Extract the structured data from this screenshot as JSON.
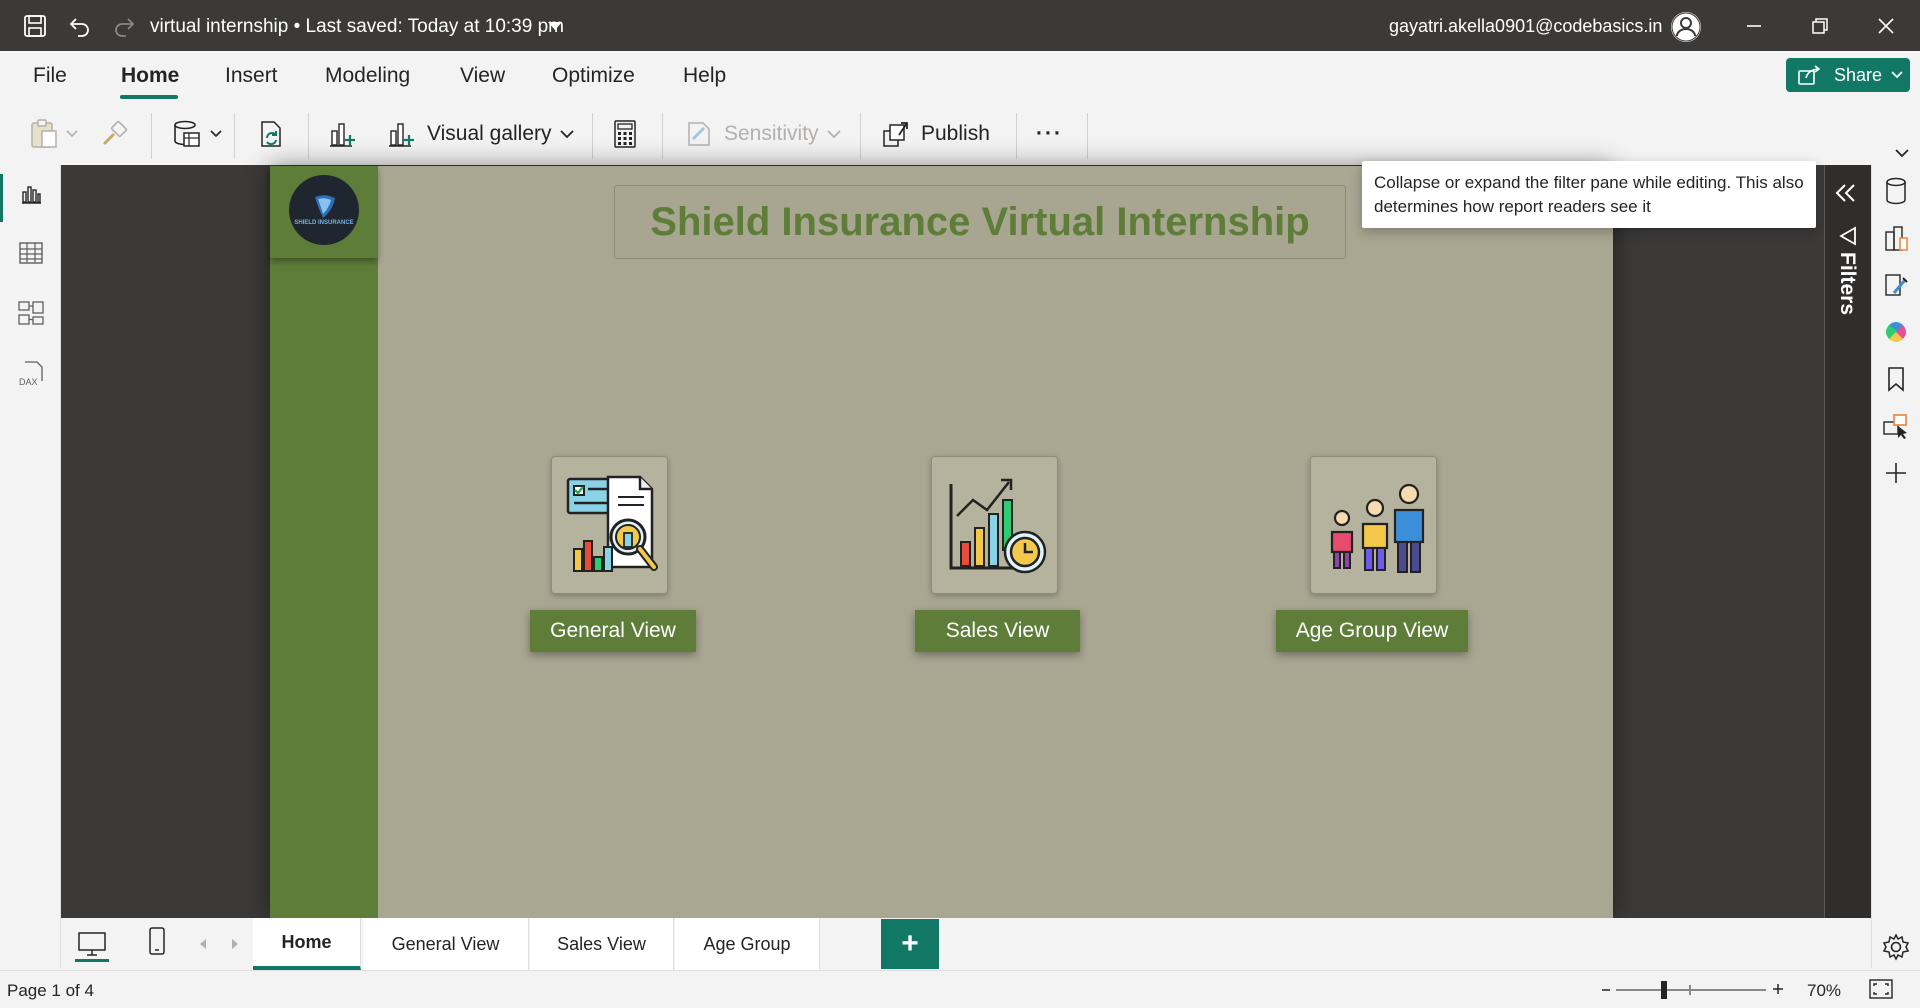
{
  "titlebar": {
    "doc_title": "virtual internship • Last saved: Today at 10:39 pm",
    "user_email": "gayatri.akella0901@codebasics.in"
  },
  "ribbon": {
    "tabs": [
      {
        "label": "File"
      },
      {
        "label": "Home"
      },
      {
        "label": "Insert"
      },
      {
        "label": "Modeling"
      },
      {
        "label": "View"
      },
      {
        "label": "Optimize"
      },
      {
        "label": "Help"
      }
    ],
    "active_tab": "Home",
    "share_label": "Share",
    "toolbar": {
      "visual_gallery": "Visual gallery",
      "sensitivity": "Sensitivity",
      "publish": "Publish",
      "more": "···"
    }
  },
  "report": {
    "logo_text": "SHIELD INSURANCE",
    "title": "Shield Insurance Virtual Internship",
    "nav_buttons": [
      {
        "label": "General View",
        "icon": "report-search-icon"
      },
      {
        "label": "Sales View",
        "icon": "sales-chart-icon"
      },
      {
        "label": "Age Group View",
        "icon": "age-group-icon"
      }
    ]
  },
  "tooltip": {
    "text": "Collapse or expand the filter pane while editing. This also determines how report readers see it"
  },
  "filters": {
    "label": "Filters"
  },
  "page_tabs": [
    {
      "label": "Home",
      "active": true
    },
    {
      "label": "General View",
      "active": false
    },
    {
      "label": "Sales View",
      "active": false
    },
    {
      "label": "Age Group",
      "active": false
    }
  ],
  "add_page_label": "+",
  "status": {
    "page_indicator": "Page 1 of 4",
    "zoom": "70%"
  },
  "colors": {
    "accent": "#117865",
    "report_green": "#5d7d39",
    "report_bg": "#a9a792",
    "titlebar": "#3b3a39"
  }
}
